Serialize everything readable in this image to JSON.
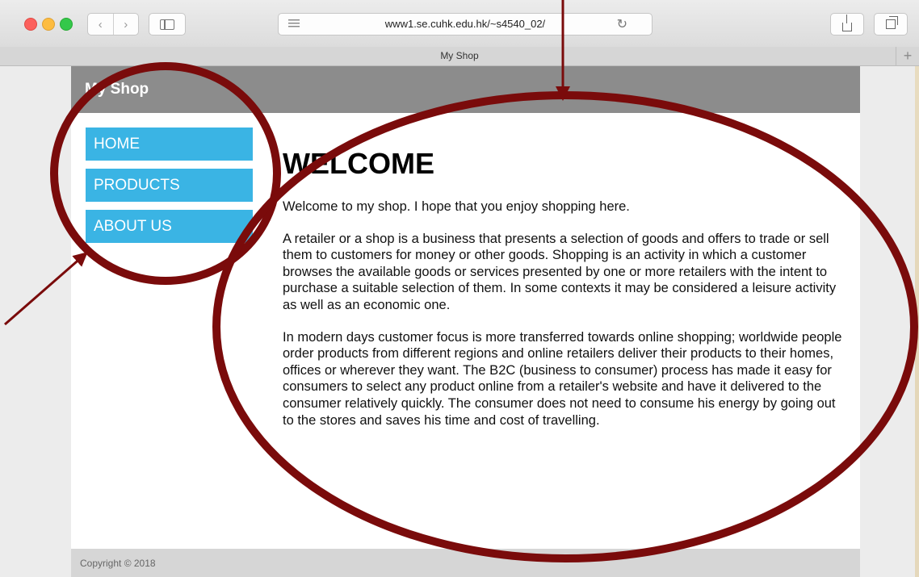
{
  "browser": {
    "url": "www1.se.cuhk.edu.hk/~s4540_02/",
    "tab_title": "My Shop",
    "back_glyph": "‹",
    "forward_glyph": "›",
    "reload_glyph": "↻",
    "new_tab_glyph": "+"
  },
  "site": {
    "title": "My Shop",
    "menu": [
      {
        "label": "HOME"
      },
      {
        "label": "PRODUCTS"
      },
      {
        "label": "ABOUT US"
      }
    ],
    "heading": "WELCOME",
    "paragraphs": [
      "Welcome to my shop. I hope that you enjoy shopping here.",
      "A retailer or a shop is a business that presents a selection of goods and offers to trade or sell them to customers for money or other goods. Shopping is an activity in which a customer browses the available goods or services presented by one or more retailers with the intent to purchase a suitable selection of them. In some contexts it may be considered a leisure activity as well as an economic one.",
      "In modern days customer focus is more transferred towards online shopping; worldwide people order products from different regions and online retailers deliver their products to their homes, offices or wherever they want. The B2C (business to consumer) process has made it easy for consumers to select any product online from a retailer's website and have it delivered to the consumer relatively quickly. The consumer does not need to consume his energy by going out to the stores and saves his time and cost of travelling."
    ],
    "footer": "Copyright © 2018"
  },
  "colors": {
    "menu_bg": "#3ab4e4",
    "header_bg": "#8c8c8c",
    "annotation": "#7a0b0b"
  }
}
